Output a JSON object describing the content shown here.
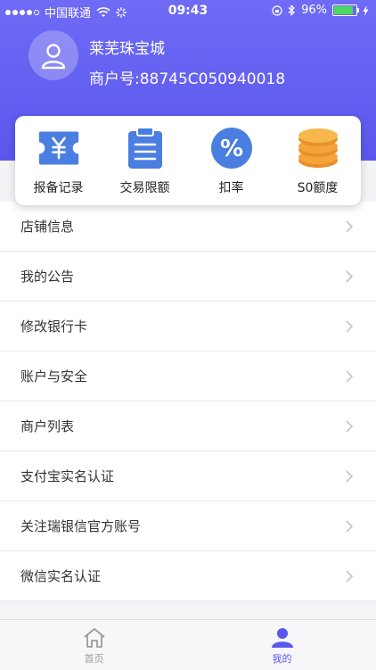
{
  "status_bar": {
    "carrier": "中国联通",
    "time": "09:43",
    "battery": "96%"
  },
  "header": {
    "merchant_name": "莱芜珠宝城",
    "merchant_no": "商户号:88745C050940018"
  },
  "quick_actions": [
    {
      "label": "报备记录",
      "icon": "yen-ticket-icon"
    },
    {
      "label": "交易限额",
      "icon": "clipboard-icon"
    },
    {
      "label": "扣率",
      "icon": "percent-icon"
    },
    {
      "label": "S0额度",
      "icon": "coin-stack-icon"
    }
  ],
  "menu": [
    {
      "label": "店铺信息"
    },
    {
      "label": "我的公告"
    },
    {
      "label": "修改银行卡"
    },
    {
      "label": "账户与安全"
    },
    {
      "label": "商户列表"
    },
    {
      "label": "支付宝实名认证"
    },
    {
      "label": "关注瑞银信官方账号"
    },
    {
      "label": "微信实名认证"
    }
  ],
  "tabs": [
    {
      "label": "首页",
      "icon": "home-icon",
      "active": false
    },
    {
      "label": "我的",
      "icon": "user-icon",
      "active": true
    }
  ],
  "colors": {
    "brand": "#5b57ee",
    "accent_blue": "#4a7ee0",
    "coin_orange": "#f0a030",
    "tab_inactive": "#9a9aa0"
  }
}
